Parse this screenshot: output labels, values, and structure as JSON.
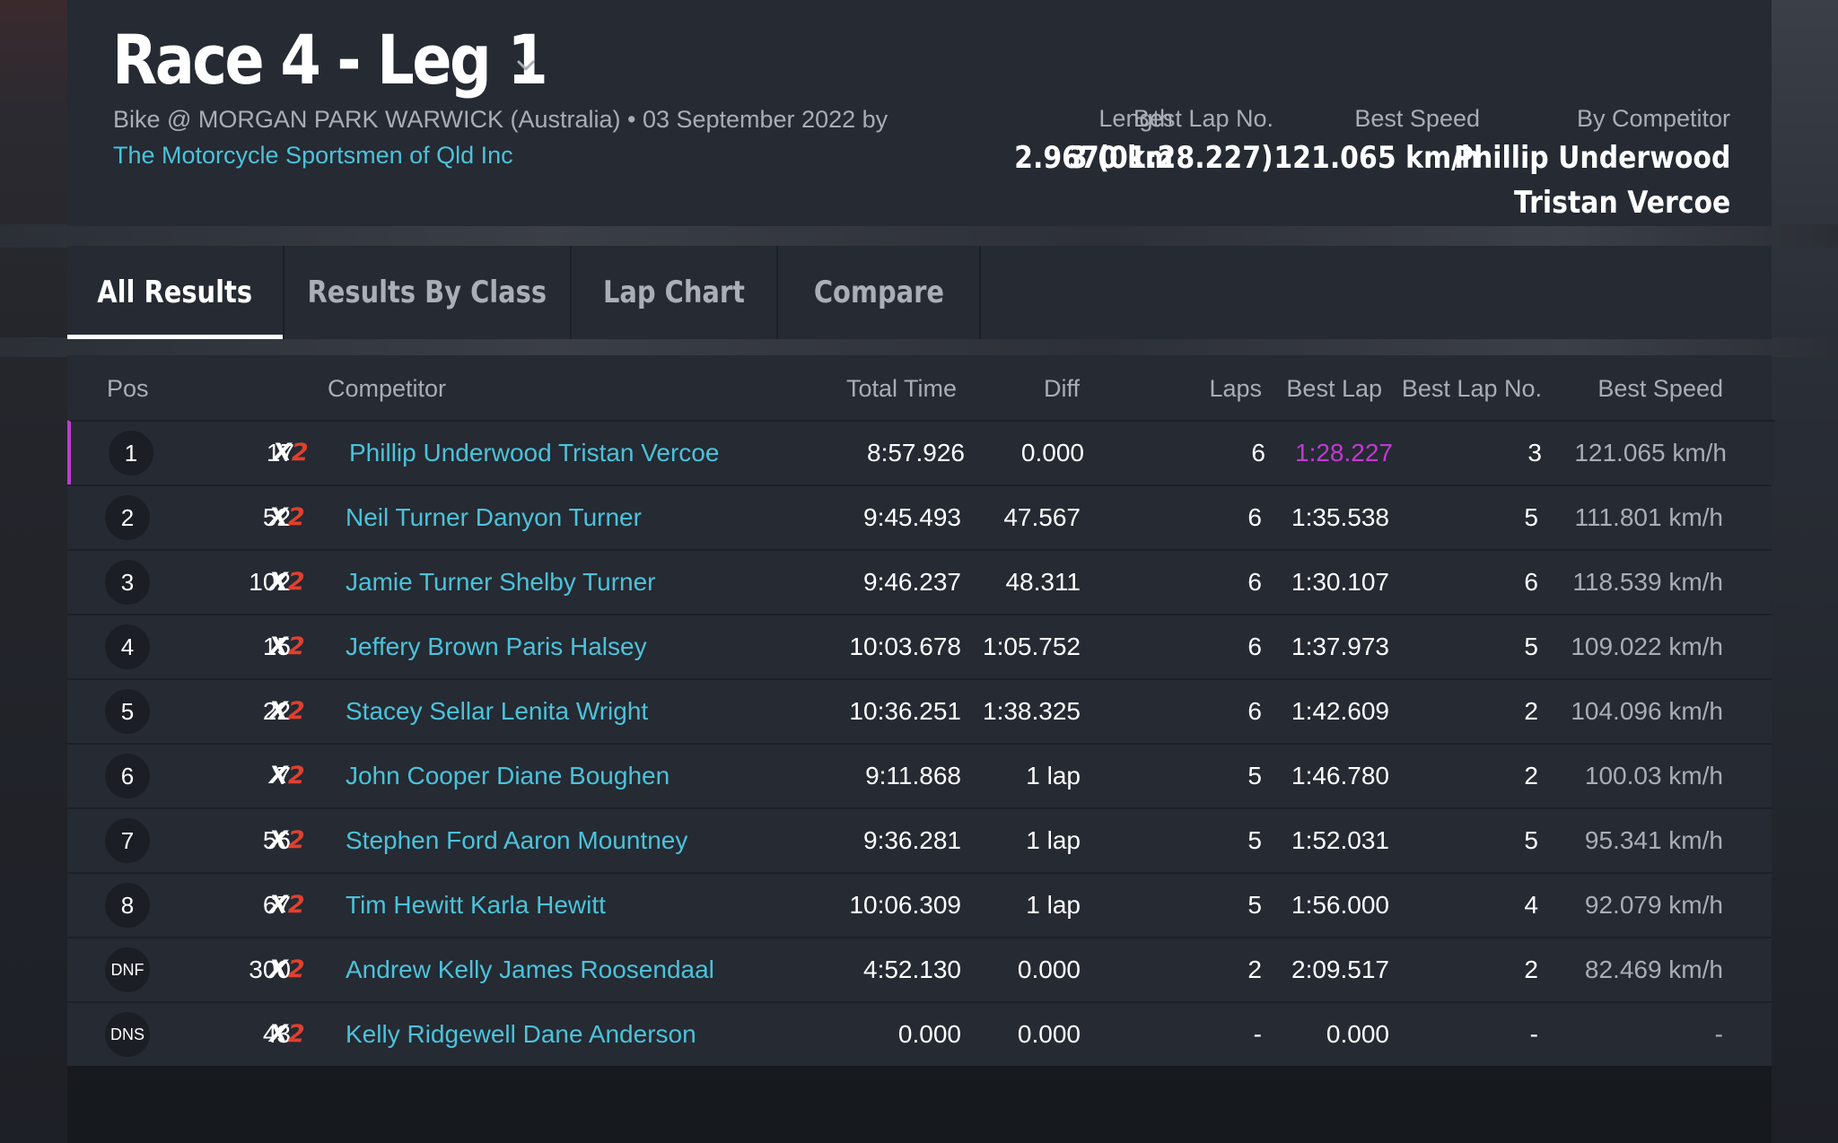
{
  "header": {
    "title": "Race 4 - Leg 1",
    "subtitle_line1": "Bike @ MORGAN PARK WARWICK (Australia) • 03 September 2022 by",
    "organizer": "The Motorcycle Sportsmen of Qld Inc",
    "stats": {
      "length_label": "Length",
      "length_value": "2.9670 km",
      "best_lap_no_label": "Best Lap No.",
      "best_lap_no_value": "3 (01:28.227)",
      "best_speed_label": "Best Speed",
      "best_speed_value": "121.065 km/h",
      "by_competitor_label": "By Competitor",
      "by_competitor_line1": "Phillip Underwood",
      "by_competitor_line2": "Tristan Vercoe"
    }
  },
  "tabs": [
    {
      "label": "All Results",
      "active": true
    },
    {
      "label": "Results By Class",
      "active": false
    },
    {
      "label": "Lap Chart",
      "active": false
    },
    {
      "label": "Compare",
      "active": false
    }
  ],
  "table": {
    "columns": {
      "pos": "Pos",
      "competitor": "Competitor",
      "total_time": "Total Time",
      "diff": "Diff",
      "laps": "Laps",
      "best_lap": "Best Lap",
      "best_lap_no": "Best Lap No.",
      "best_speed": "Best Speed"
    },
    "brand": {
      "x": "X",
      "two": "2"
    },
    "rows": [
      {
        "pos": "1",
        "num": "17",
        "competitor": "Phillip Underwood Tristan Vercoe",
        "total_time": "8:57.926",
        "diff": "0.000",
        "laps": "6",
        "best_lap": "1:28.227",
        "best_lap_no": "3",
        "best_speed": "121.065 km/h"
      },
      {
        "pos": "2",
        "num": "52",
        "competitor": "Neil Turner Danyon Turner",
        "total_time": "9:45.493",
        "diff": "47.567",
        "laps": "6",
        "best_lap": "1:35.538",
        "best_lap_no": "5",
        "best_speed": "111.801 km/h"
      },
      {
        "pos": "3",
        "num": "102",
        "competitor": "Jamie Turner Shelby Turner",
        "total_time": "9:46.237",
        "diff": "48.311",
        "laps": "6",
        "best_lap": "1:30.107",
        "best_lap_no": "6",
        "best_speed": "118.539 km/h"
      },
      {
        "pos": "4",
        "num": "15",
        "competitor": "Jeffery Brown Paris Halsey",
        "total_time": "10:03.678",
        "diff": "1:05.752",
        "laps": "6",
        "best_lap": "1:37.973",
        "best_lap_no": "5",
        "best_speed": "109.022 km/h"
      },
      {
        "pos": "5",
        "num": "22",
        "competitor": "Stacey Sellar Lenita Wright",
        "total_time": "10:36.251",
        "diff": "1:38.325",
        "laps": "6",
        "best_lap": "1:42.609",
        "best_lap_no": "2",
        "best_speed": "104.096 km/h"
      },
      {
        "pos": "6",
        "num": "7",
        "competitor": "John Cooper Diane Boughen",
        "total_time": "9:11.868",
        "diff": "1 lap",
        "laps": "5",
        "best_lap": "1:46.780",
        "best_lap_no": "2",
        "best_speed": "100.03 km/h"
      },
      {
        "pos": "7",
        "num": "56",
        "competitor": "Stephen Ford Aaron Mountney",
        "total_time": "9:36.281",
        "diff": "1 lap",
        "laps": "5",
        "best_lap": "1:52.031",
        "best_lap_no": "5",
        "best_speed": "95.341 km/h"
      },
      {
        "pos": "8",
        "num": "67",
        "competitor": "Tim Hewitt Karla Hewitt",
        "total_time": "10:06.309",
        "diff": "1 lap",
        "laps": "5",
        "best_lap": "1:56.000",
        "best_lap_no": "4",
        "best_speed": "92.079 km/h"
      },
      {
        "pos": "DNF",
        "num": "300",
        "competitor": "Andrew Kelly James Roosendaal",
        "total_time": "4:52.130",
        "diff": "0.000",
        "laps": "2",
        "best_lap": "2:09.517",
        "best_lap_no": "2",
        "best_speed": "82.469 km/h"
      },
      {
        "pos": "DNS",
        "num": "43",
        "competitor": "Kelly Ridgewell Dane Anderson",
        "total_time": "0.000",
        "diff": "0.000",
        "laps": "-",
        "best_lap": "0.000",
        "best_lap_no": "-",
        "best_speed": "-"
      }
    ]
  },
  "colors": {
    "accent_link": "#4cc2d9",
    "best_lap_highlight": "#c13ad1",
    "brand_red": "#e0402e",
    "panel": "#252a33"
  }
}
